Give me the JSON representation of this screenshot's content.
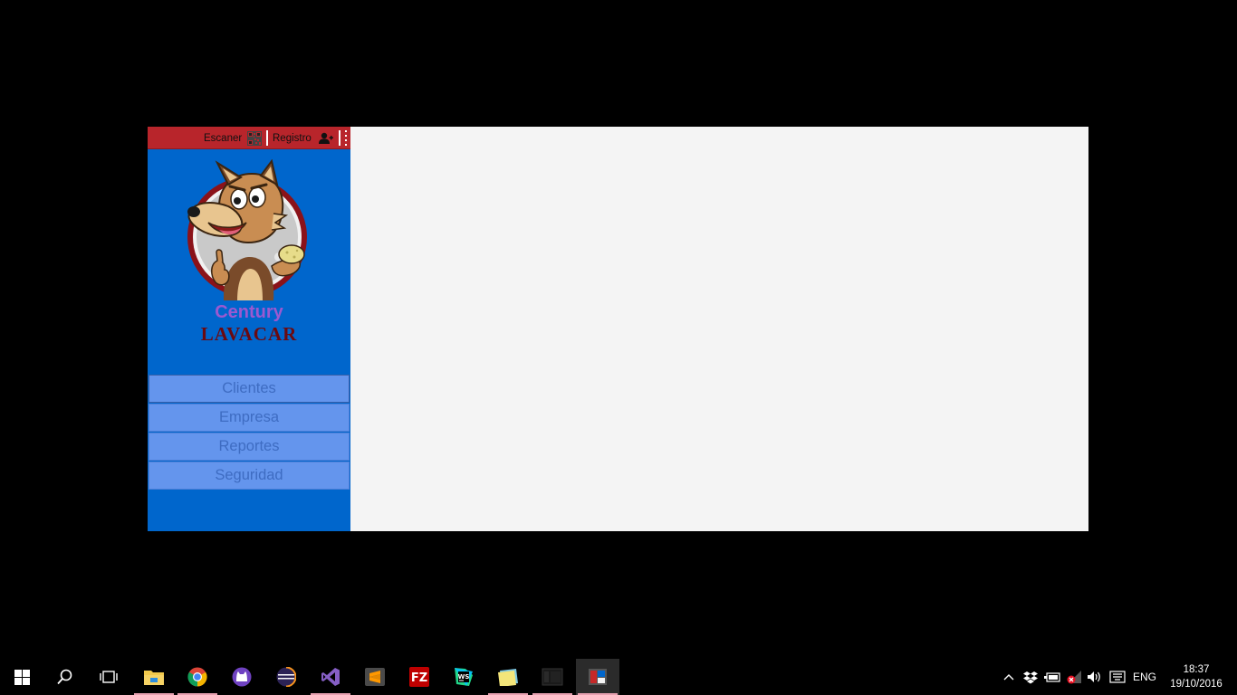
{
  "app": {
    "topbar": {
      "scan_label": "Escaner",
      "register_label": "Registro"
    },
    "brand": {
      "name": "Century",
      "subtitle": "LAVACAR"
    },
    "menu": [
      {
        "label": "Clientes"
      },
      {
        "label": "Empresa"
      },
      {
        "label": "Reportes"
      },
      {
        "label": "Seguridad"
      }
    ],
    "colors": {
      "topbar": "#B8252B",
      "sidebar": "#0066CC",
      "menu_item": "#6495ED",
      "content": "#F4F4F4"
    }
  },
  "taskbar": {
    "apps": [
      {
        "icon": "windows-start-icon"
      },
      {
        "icon": "search-icon"
      },
      {
        "icon": "task-view-icon"
      },
      {
        "icon": "file-explorer-icon"
      },
      {
        "icon": "chrome-icon"
      },
      {
        "icon": "github-desktop-icon"
      },
      {
        "icon": "eclipse-icon"
      },
      {
        "icon": "visual-studio-icon"
      },
      {
        "icon": "sublime-text-icon"
      },
      {
        "icon": "filezilla-icon"
      },
      {
        "icon": "webstorm-icon"
      },
      {
        "icon": "sticky-notes-icon"
      },
      {
        "icon": "app-window-icon"
      },
      {
        "icon": "app-window-icon"
      }
    ],
    "tray": {
      "language": "ENG",
      "time": "18:37",
      "date": "19/10/2016"
    }
  }
}
